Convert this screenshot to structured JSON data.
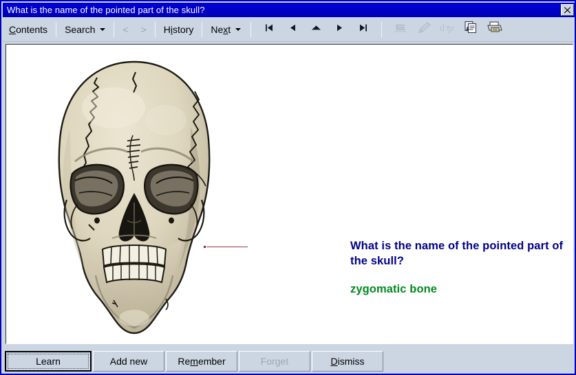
{
  "window": {
    "title": "What is the name of the pointed part of the skull?",
    "close_label": "close-window",
    "accent_titlebar": "#0000cc",
    "accent_toolbar": "#ccd6e3"
  },
  "toolbar": {
    "items": [
      {
        "label": "Contents",
        "accel": "C",
        "type": "text",
        "disabled": false,
        "dropdown": false,
        "icon": ""
      },
      {
        "label": "separator",
        "accel": "",
        "type": "sep",
        "disabled": false,
        "dropdown": false,
        "icon": ""
      },
      {
        "label": "Search",
        "accel": "",
        "type": "text",
        "disabled": false,
        "dropdown": true,
        "icon": ""
      },
      {
        "label": "separator",
        "accel": "",
        "type": "sep",
        "disabled": false,
        "dropdown": false,
        "icon": ""
      },
      {
        "label": "<",
        "accel": "",
        "type": "text",
        "disabled": true,
        "dropdown": false,
        "icon": "back-arrow-icon"
      },
      {
        "label": ">",
        "accel": "",
        "type": "text",
        "disabled": true,
        "dropdown": false,
        "icon": "forward-arrow-icon"
      },
      {
        "label": "separator",
        "accel": "",
        "type": "sep",
        "disabled": false,
        "dropdown": false,
        "icon": ""
      },
      {
        "label": "History",
        "accel": "i",
        "type": "text",
        "disabled": false,
        "dropdown": false,
        "icon": ""
      },
      {
        "label": "separator",
        "accel": "",
        "type": "sep",
        "disabled": false,
        "dropdown": false,
        "icon": ""
      },
      {
        "label": "Next",
        "accel": "x",
        "type": "text",
        "disabled": false,
        "dropdown": true,
        "icon": ""
      },
      {
        "label": "separator",
        "accel": "",
        "type": "sep",
        "disabled": false,
        "dropdown": false,
        "icon": ""
      }
    ],
    "nav_icons": [
      {
        "name": "first-page-icon",
        "glyph": "|<",
        "disabled": false
      },
      {
        "name": "previous-page-icon",
        "glyph": "<",
        "disabled": false
      },
      {
        "name": "up-page-icon",
        "glyph": "^",
        "disabled": false
      },
      {
        "name": "next-page-icon",
        "glyph": ">",
        "disabled": false
      },
      {
        "name": "last-page-icon",
        "glyph": ">|",
        "disabled": false
      }
    ],
    "tool_icons": [
      {
        "name": "highlighter-icon",
        "disabled": true
      },
      {
        "name": "pen-icon",
        "disabled": true
      },
      {
        "name": "dze-text-icon",
        "disabled": true
      },
      {
        "name": "copy-icon",
        "disabled": false
      },
      {
        "name": "print-icon",
        "disabled": false
      }
    ]
  },
  "content": {
    "figure": {
      "name": "skull-illustration",
      "alt": "Anatomical front view illustration of a human skull",
      "pointer_target": "zygomatic bone",
      "bone_color": "#ded6bd",
      "shadow_color": "#a8a08a"
    },
    "question": "What is the name of the pointed part of the skull?",
    "answer": "zygomatic bone",
    "question_color": "#00008b",
    "answer_color": "#008a1e"
  },
  "buttons": {
    "items": [
      {
        "label": "Learn",
        "accel": "",
        "disabled": false,
        "default": true
      },
      {
        "label": "Add new",
        "accel": "",
        "disabled": false,
        "default": false
      },
      {
        "label": "Remember",
        "accel": "m",
        "disabled": false,
        "default": false
      },
      {
        "label": "Forget",
        "accel": "g",
        "disabled": true,
        "default": false
      },
      {
        "label": "Dismiss",
        "accel": "D",
        "disabled": false,
        "default": false
      }
    ]
  }
}
